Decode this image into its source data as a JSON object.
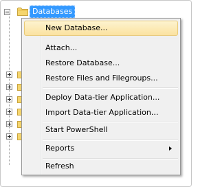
{
  "tree": {
    "root_label": "Databases",
    "root_expander": "minus",
    "collapsed_nodes": 6
  },
  "context_menu": {
    "items": [
      {
        "label": "New Database...",
        "highlighted": true
      },
      {
        "label": "Attach..."
      },
      {
        "label": "Restore Database..."
      },
      {
        "label": "Restore Files and Filegroups..."
      },
      {
        "label": "Deploy Data-tier Application..."
      },
      {
        "label": "Import Data-tier Application..."
      },
      {
        "label": "Start PowerShell"
      },
      {
        "label": "Reports",
        "submenu": true
      },
      {
        "label": "Refresh"
      }
    ]
  },
  "icons": {
    "folder": "folder-icon",
    "expander_expanded": "minus-box-icon",
    "expander_collapsed": "plus-box-icon",
    "submenu": "submenu-arrow-icon"
  },
  "colors": {
    "selection": "#3399ff",
    "highlight_top": "#fdf3cf",
    "highlight_bottom": "#fbe2a0",
    "highlight_border": "#e8c874",
    "menu_bg": "#f0f0f0",
    "folder": "#f5d56d"
  }
}
